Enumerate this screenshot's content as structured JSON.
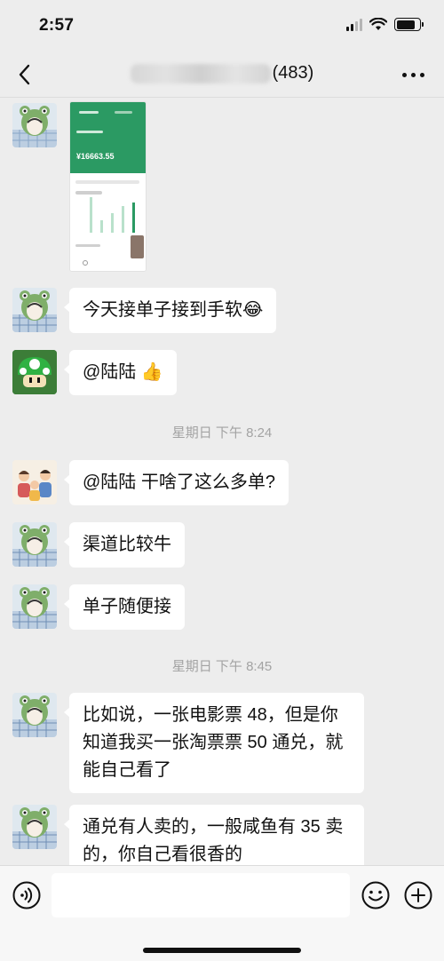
{
  "status_bar": {
    "time": "2:57"
  },
  "header": {
    "title_count": "(483)"
  },
  "messages": [
    {
      "text": "今天接单子接到手软"
    },
    {
      "text": "@陆陆"
    },
    {
      "text": "@陆陆 干啥了这么多单?"
    },
    {
      "text": "渠道比较牛"
    },
    {
      "text": "单子随便接"
    },
    {
      "text": "比如说，一张电影票 48，但是你知道我买一张淘票票 50 通兑，就能自己看了"
    },
    {
      "text": "通兑有人卖的，一般咸鱼有 35 卖的，你自己看很香的"
    }
  ],
  "image_message": {
    "amount": "¥16663.55"
  },
  "timestamps": [
    "星期日 下午 8:24",
    "星期日 下午 8:45"
  ],
  "emoji": {
    "laugh": "😂",
    "thumbs_up": "👍"
  },
  "icons": {
    "back": "chevron-left-icon",
    "more": "more-dots-icon",
    "voice": "voice-icon",
    "emoji": "emoji-face-icon",
    "plus": "plus-icon"
  },
  "colors": {
    "background": "#ededed",
    "bubble": "#ffffff",
    "accent_green": "#2b9a63"
  }
}
